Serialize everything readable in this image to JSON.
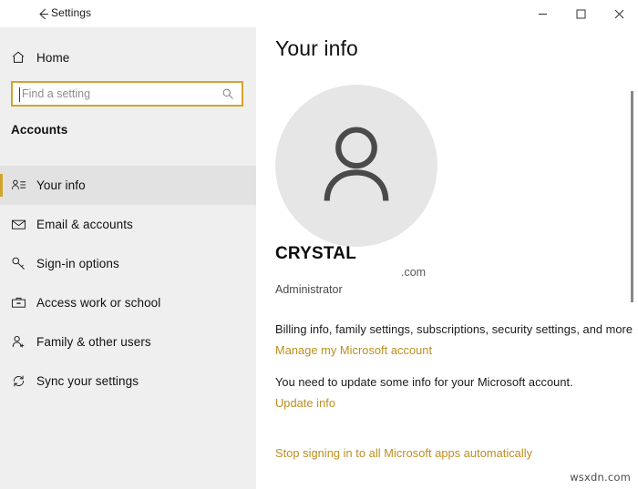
{
  "window": {
    "title": "Settings",
    "back_icon": "back-arrow-icon",
    "controls": {
      "minimize": "minimize-icon",
      "maximize": "maximize-icon",
      "close": "close-icon"
    }
  },
  "sidebar": {
    "home": {
      "label": "Home",
      "icon": "home-icon"
    },
    "search": {
      "placeholder": "Find a setting",
      "value": "",
      "icon": "search-icon"
    },
    "section_heading": "Accounts",
    "items": [
      {
        "label": "Your info",
        "icon": "user-card-icon",
        "selected": true
      },
      {
        "label": "Email & accounts",
        "icon": "envelope-icon",
        "selected": false
      },
      {
        "label": "Sign-in options",
        "icon": "key-icon",
        "selected": false
      },
      {
        "label": "Access work or school",
        "icon": "briefcase-icon",
        "selected": false
      },
      {
        "label": "Family & other users",
        "icon": "user-plus-icon",
        "selected": false
      },
      {
        "label": "Sync your settings",
        "icon": "sync-icon",
        "selected": false
      }
    ]
  },
  "main": {
    "page_title": "Your info",
    "avatar_icon": "person-avatar-icon",
    "account_name": "CRYSTAL",
    "account_email": ".com",
    "account_role": "Administrator",
    "billing_text": "Billing info, family settings, subscriptions, security settings, and more",
    "manage_account_link": "Manage my Microsoft account",
    "update_notice": "You need to update some info for your Microsoft account.",
    "update_info_link": "Update info",
    "stop_signing_link": "Stop signing in to all Microsoft apps automatically"
  },
  "scrollbar": {
    "name": "vertical-scrollbar"
  },
  "watermark": "wsxdn.com",
  "colors": {
    "accent": "#d2a32e",
    "link": "#bc8f1f",
    "sidebar_bg": "#efefef",
    "content_bg": "#ffffff",
    "avatar_bg": "#e6e6e6"
  }
}
